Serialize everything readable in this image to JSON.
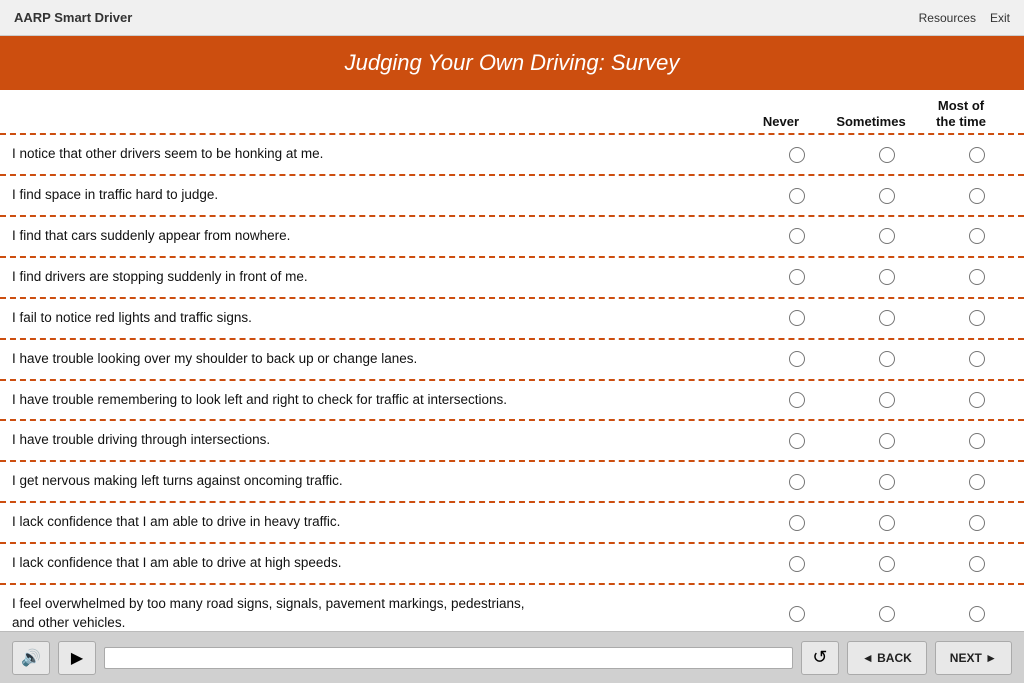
{
  "app": {
    "title": "AARP Smart Driver"
  },
  "topbar": {
    "resources_label": "Resources",
    "exit_label": "Exit"
  },
  "page": {
    "header_title": "Judging Your Own Driving: Survey"
  },
  "columns": {
    "never": "Never",
    "sometimes": "Sometimes",
    "most_of_the_time_line1": "Most of",
    "most_of_the_time_line2": "the time"
  },
  "survey_items": [
    "I notice that other drivers seem to be honking at me.",
    "I find space in traffic hard to judge.",
    "I find that cars suddenly appear from nowhere.",
    "I find drivers are stopping suddenly in front of me.",
    "I fail to notice red lights and traffic signs.",
    "I have trouble looking over my shoulder to back up or change lanes.",
    "I have trouble remembering to look left and right to check for traffic at intersections.",
    "I have trouble driving through intersections.",
    "I get nervous making left turns against oncoming traffic.",
    "I lack confidence that I am able to drive in heavy traffic.",
    "I lack confidence that I am able to drive at high speeds.",
    "I feel overwhelmed by too many road signs, signals, pavement markings, pedestrians,\nand other vehicles."
  ],
  "bottom": {
    "back_label": "◄ BACK",
    "next_label": "NEXT ►",
    "volume_icon": "🔊",
    "play_icon": "▶",
    "reload_icon": "↺"
  }
}
